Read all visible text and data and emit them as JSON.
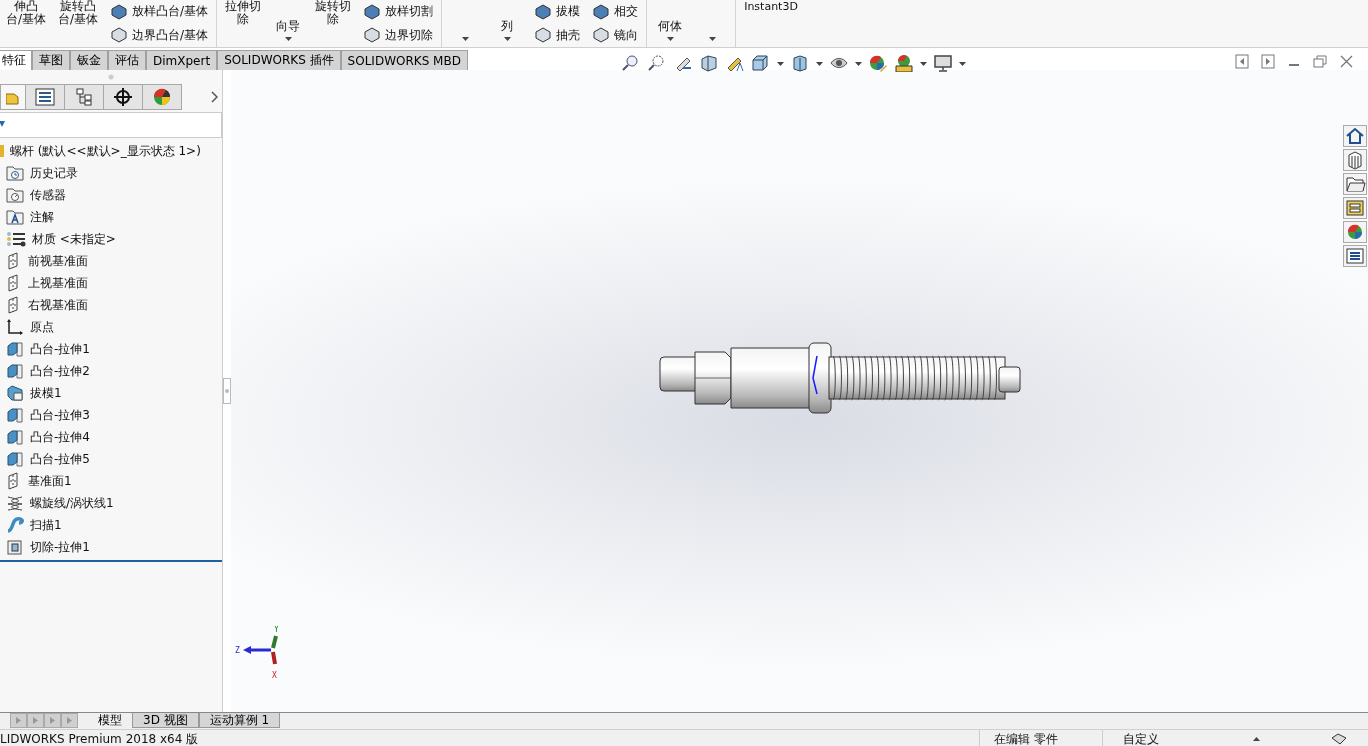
{
  "ribbon": [
    {
      "kind": "large",
      "lines": [
        "伸凸",
        "台/基体"
      ]
    },
    {
      "kind": "large",
      "lines": [
        "旋转凸",
        "台/基体"
      ]
    },
    {
      "kind": "small",
      "items": [
        "放样凸台/基体",
        "边界凸台/基体"
      ]
    },
    {
      "kind": "sep"
    },
    {
      "kind": "large",
      "lines": [
        "拉伸切",
        "除"
      ]
    },
    {
      "kind": "dropdown",
      "lines": [
        "向导"
      ]
    },
    {
      "kind": "large",
      "lines": [
        "旋转切",
        "除"
      ]
    },
    {
      "kind": "small",
      "items": [
        "放样切割",
        "边界切除"
      ]
    },
    {
      "kind": "sep"
    },
    {
      "kind": "dropdown"
    },
    {
      "kind": "dropdown",
      "lines": [
        "列"
      ]
    },
    {
      "kind": "small",
      "items": [
        "拔模",
        "抽壳"
      ]
    },
    {
      "kind": "small",
      "items": [
        "相交",
        "镜向"
      ]
    },
    {
      "kind": "sep"
    },
    {
      "kind": "dropdown",
      "lines": [
        "何体"
      ]
    },
    {
      "kind": "dropdown"
    },
    {
      "kind": "sep"
    },
    {
      "kind": "text",
      "label": "Instant3D"
    }
  ],
  "tabs": [
    {
      "label": "特征",
      "selected": true
    },
    {
      "label": "草图",
      "selected": false
    },
    {
      "label": "钣金",
      "selected": false
    },
    {
      "label": "评估",
      "selected": false
    },
    {
      "label": "DimXpert",
      "selected": false
    },
    {
      "label": "SOLIDWORKS 插件",
      "selected": false
    },
    {
      "label": "SOLIDWORKS MBD",
      "selected": false
    }
  ],
  "tree": {
    "root": "螺杆 (默认<<默认>_显示状态 1>)",
    "children": [
      {
        "kind": "history",
        "label": "历史记录"
      },
      {
        "kind": "sensor",
        "label": "传感器"
      },
      {
        "kind": "annotation",
        "label": "注解"
      },
      {
        "kind": "material",
        "label": "材质 <未指定>"
      },
      {
        "kind": "plane",
        "label": "前视基准面"
      },
      {
        "kind": "plane",
        "label": "上视基准面"
      },
      {
        "kind": "plane",
        "label": "右视基准面"
      },
      {
        "kind": "origin",
        "label": "原点"
      },
      {
        "kind": "boss",
        "label": "凸台-拉伸1"
      },
      {
        "kind": "boss",
        "label": "凸台-拉伸2"
      },
      {
        "kind": "draft",
        "label": "拔模1"
      },
      {
        "kind": "boss",
        "label": "凸台-拉伸3"
      },
      {
        "kind": "boss",
        "label": "凸台-拉伸4"
      },
      {
        "kind": "boss",
        "label": "凸台-拉伸5"
      },
      {
        "kind": "plane",
        "label": "基准面1"
      },
      {
        "kind": "helix",
        "label": "螺旋线/涡状线1"
      },
      {
        "kind": "sweep",
        "label": "扫描1"
      },
      {
        "kind": "cut",
        "label": "切除-拉伸1"
      }
    ]
  },
  "triad": {
    "y": "Y",
    "z": "Z",
    "x": "X"
  },
  "bottom_tabs": [
    {
      "label": "模型",
      "selected": true
    },
    {
      "label": "3D 视图",
      "selected": false
    },
    {
      "label": "运动算例 1",
      "selected": false
    }
  ],
  "status_bar": {
    "product": "LIDWORKS Premium 2018 x64 版",
    "mode": "在编辑 零件",
    "units": "自定义"
  }
}
